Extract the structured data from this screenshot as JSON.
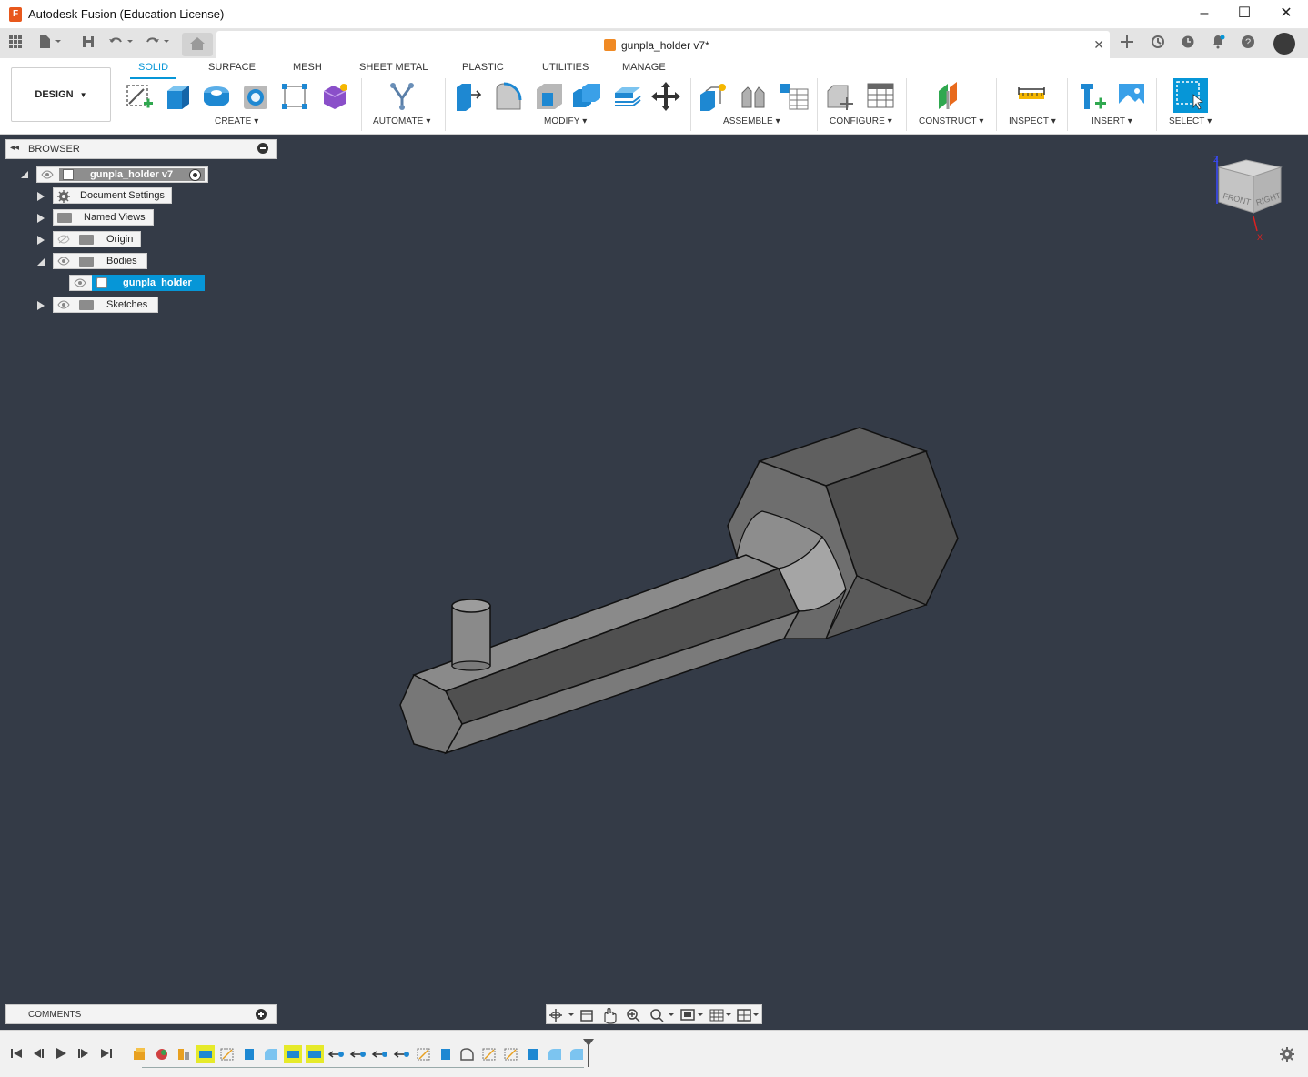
{
  "window": {
    "app_title": "Autodesk Fusion (Education License)",
    "controls": [
      "minimize-icon",
      "maximize-icon",
      "close-icon"
    ]
  },
  "document_tab": {
    "name": "gunpla_holder v7*",
    "close_label": "✕"
  },
  "workspace": {
    "label": "DESIGN"
  },
  "ribbon_tabs": [
    {
      "label": "SOLID",
      "active": true
    },
    {
      "label": "SURFACE",
      "active": false
    },
    {
      "label": "MESH",
      "active": false
    },
    {
      "label": "SHEET METAL",
      "active": false
    },
    {
      "label": "PLASTIC",
      "active": false
    },
    {
      "label": "UTILITIES",
      "active": false
    },
    {
      "label": "MANAGE",
      "active": false
    }
  ],
  "ribbon_groups": [
    {
      "label": "CREATE"
    },
    {
      "label": "AUTOMATE"
    },
    {
      "label": "MODIFY"
    },
    {
      "label": "ASSEMBLE"
    },
    {
      "label": "CONFIGURE"
    },
    {
      "label": "CONSTRUCT"
    },
    {
      "label": "INSPECT"
    },
    {
      "label": "INSERT"
    },
    {
      "label": "SELECT"
    }
  ],
  "browser": {
    "title": "BROWSER",
    "root": "gunpla_holder v7",
    "items": [
      {
        "label": "Document Settings"
      },
      {
        "label": "Named Views"
      },
      {
        "label": "Origin"
      },
      {
        "label": "Bodies"
      },
      {
        "label": "gunpla_holder",
        "selected": true
      },
      {
        "label": "Sketches"
      }
    ]
  },
  "viewcube": {
    "front": "FRONT",
    "right": "RIGHT",
    "axis_z": "Z",
    "axis_x": "X"
  },
  "comments": {
    "label": "COMMENTS"
  },
  "colors": {
    "accent": "#0696d7",
    "viewport_bg": "#343b47",
    "highlight": "#e6ea2a",
    "model": "#7a7a7a"
  }
}
